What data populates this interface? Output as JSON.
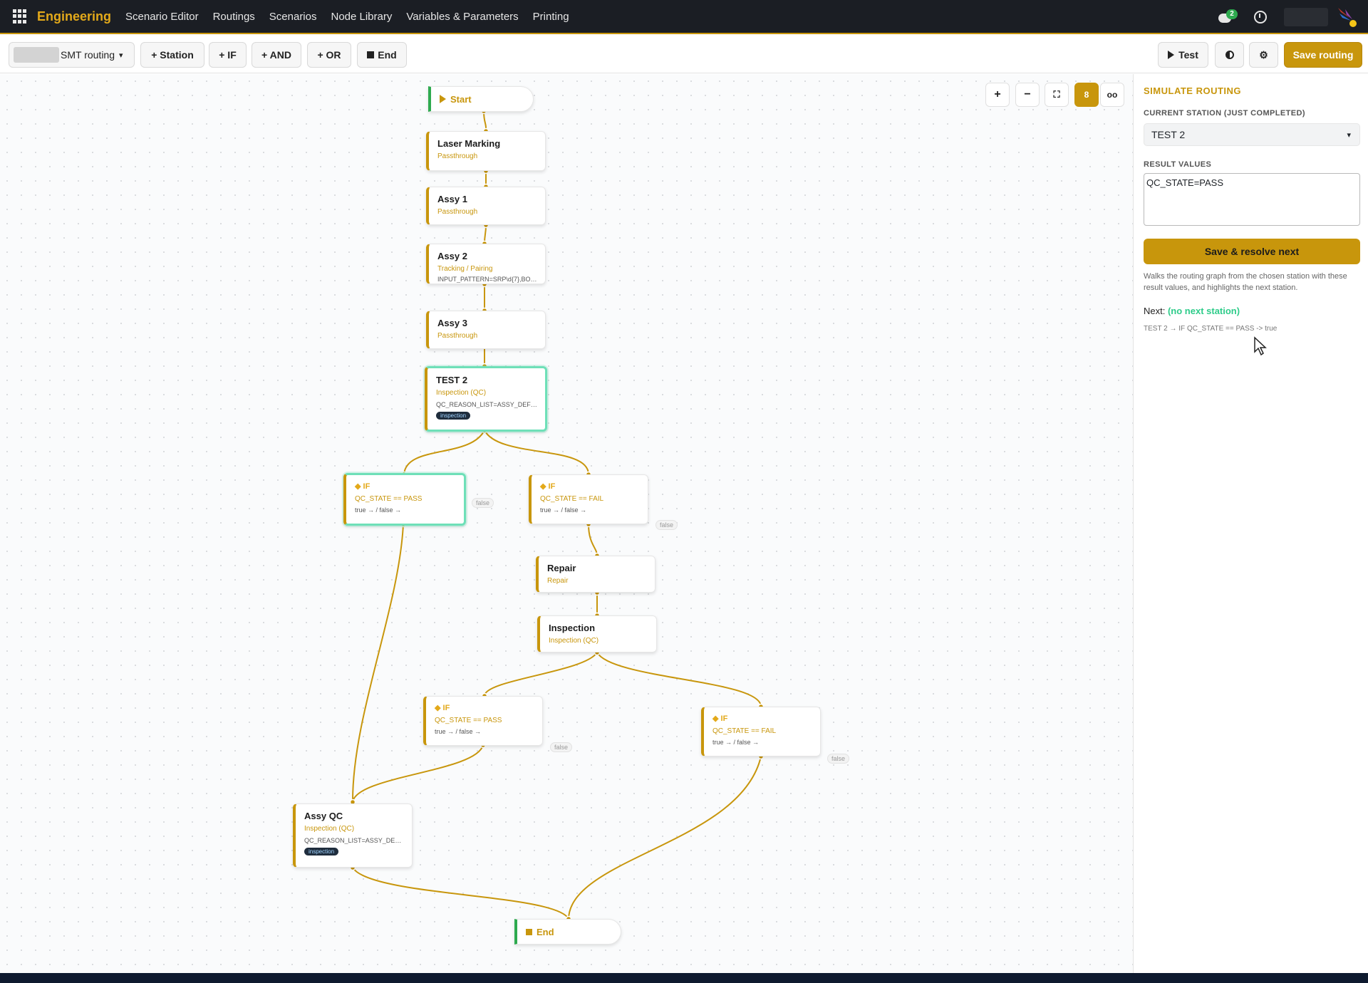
{
  "nav": {
    "brand": "Engineering",
    "links": [
      "Scenario Editor",
      "Routings",
      "Scenarios",
      "Node Library",
      "Variables & Parameters",
      "Printing"
    ],
    "chat_count": "2"
  },
  "toolbar": {
    "routing_name": "SMT routing",
    "add_station": "+ Station",
    "add_if": "+ IF",
    "add_and": "+ AND",
    "add_or": "+ OR",
    "add_end": "End",
    "test": "Test",
    "save": "Save routing"
  },
  "graph": {
    "start": "Start",
    "end": "End",
    "nodes": [
      {
        "title": "Laser Marking",
        "type": "Passthrough"
      },
      {
        "title": "Assy 1",
        "type": "Passthrough"
      },
      {
        "title": "Assy 2",
        "type": "Tracking / Pairing",
        "param": "INPUT_PATTERN=SRP\\d{7},BOX_..."
      },
      {
        "title": "Assy 3",
        "type": "Passthrough"
      },
      {
        "title": "TEST 2",
        "type": "Inspection (QC)",
        "param": "QC_REASON_LIST=ASSY_DEFEC...",
        "tag": "inspection"
      },
      {
        "title": "Repair",
        "type": "Repair"
      },
      {
        "title": "Inspection",
        "type": "Inspection (QC)"
      },
      {
        "title": "Assy QC",
        "type": "Inspection (QC)",
        "param": "QC_REASON_LIST=ASSY_DEFEC...",
        "tag": "inspection"
      }
    ],
    "conditions": [
      {
        "title": "◆ IF",
        "expr": "QC_STATE == PASS",
        "branches": "true → / false →",
        "false_label": "false"
      },
      {
        "title": "◆ IF",
        "expr": "QC_STATE == FAIL",
        "branches": "true → / false →",
        "false_label": "false"
      },
      {
        "title": "◆ IF",
        "expr": "QC_STATE == PASS",
        "branches": "true → / false →",
        "false_label": "false"
      },
      {
        "title": "◆ IF",
        "expr": "QC_STATE == FAIL",
        "branches": "true → / false →",
        "false_label": "false"
      }
    ]
  },
  "zoom_controls": {
    "zoom_in": "+",
    "zoom_out": "−"
  },
  "sidebar": {
    "heading": "SIMULATE ROUTING",
    "station_label": "CURRENT STATION (JUST COMPLETED)",
    "station_value": "TEST 2",
    "result_label": "RESULT VALUES",
    "result_value": "QC_STATE=PASS",
    "button": "Save & resolve next",
    "help": "Walks the routing graph from the chosen station with these result values, and highlights the next station.",
    "next_label": "Next:",
    "next_value": "(no next station)",
    "path": "TEST 2 → IF QC_STATE == PASS -> true"
  },
  "colors": {
    "accent": "#c8960c",
    "selected": "#6ee0b8",
    "nav_bg": "#1b1e24",
    "start_bar": "#2eaa4f"
  }
}
